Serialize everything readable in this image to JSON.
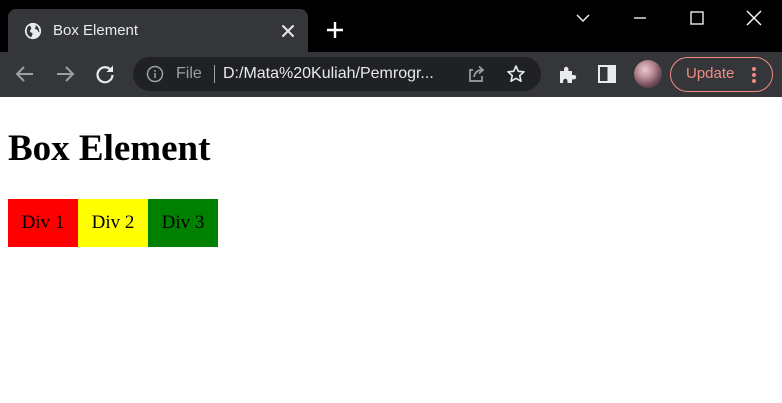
{
  "window": {
    "tab_title": "Box Element",
    "colors": {
      "titlebar": "#000000",
      "tab_active": "#35363a",
      "toolbar": "#35363a",
      "omnibox": "#202124",
      "update_accent": "#f28b82"
    }
  },
  "toolbar": {
    "back_icon": "arrow-left-icon",
    "forward_icon": "arrow-right-icon",
    "reload_icon": "reload-icon",
    "omnibox": {
      "scheme_label": "File",
      "url": "D:/Mata%20Kuliah/Pemrogr..."
    },
    "update_label": "Update"
  },
  "page": {
    "heading": "Box Element",
    "boxes": [
      {
        "label": "Div 1",
        "color": "#ff0000"
      },
      {
        "label": "Div 2",
        "color": "#ffff00"
      },
      {
        "label": "Div 3",
        "color": "#008000"
      }
    ]
  }
}
